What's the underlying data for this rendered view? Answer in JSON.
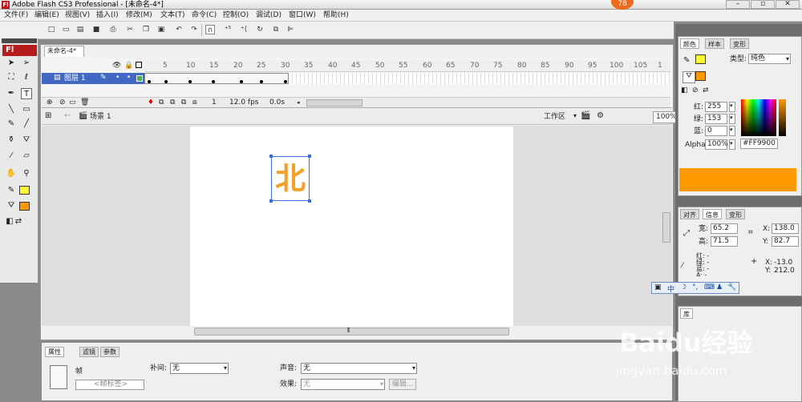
{
  "app": {
    "icon_text": "Fl",
    "title": "Adobe Flash CS3 Professional - [未命名-4*]",
    "badge": "78"
  },
  "window_buttons": [
    "–",
    "▫",
    "✕"
  ],
  "menubar": [
    "文件(F)",
    "编辑(E)",
    "视图(V)",
    "插入(I)",
    "修改(M)",
    "文本(T)",
    "命令(C)",
    "控制(O)",
    "调试(D)",
    "窗口(W)",
    "帮助(H)"
  ],
  "toolbar_icons": [
    "new-file-icon",
    "open-file-icon",
    "bridge-icon",
    "save-icon",
    "print-icon",
    "cut-icon",
    "copy-icon",
    "paste-icon",
    "undo-icon",
    "redo-icon",
    "snap-magnet-icon",
    "smooth-icon",
    "straighten-icon",
    "rotate-icon",
    "scale-icon",
    "align-icon"
  ],
  "tools": {
    "logo": "Fl",
    "items": [
      "selection-arrow-icon",
      "subselect-icon",
      "free-transform-icon",
      "lasso-icon",
      "pen-icon",
      "text-icon",
      "line-icon",
      "rectangle-icon",
      "pencil-icon",
      "brush-icon",
      "ink-bottle-icon",
      "paint-bucket-icon",
      "eyedropper-icon",
      "eraser-icon",
      "hand-icon",
      "zoom-icon"
    ]
  },
  "document": {
    "tab": "未命名-4*",
    "scene": "场景 1",
    "workspace": "工作区",
    "zoom": "100%",
    "glyph": "北"
  },
  "timeline": {
    "ticks": [
      "5",
      "10",
      "15",
      "20",
      "25",
      "30",
      "35",
      "40",
      "45",
      "50",
      "55",
      "60",
      "65",
      "70",
      "75",
      "80",
      "85",
      "90",
      "95",
      "100",
      "105",
      "1"
    ],
    "layer_name": "图层 1",
    "frame": "1",
    "fps": "12.0 fps",
    "time": "0.0s"
  },
  "color_panel": {
    "tabs": [
      "颜色",
      "样本",
      "变形"
    ],
    "type_label": "类型:",
    "type_value": "纯色",
    "red_label": "红:",
    "red": "255",
    "green_label": "绿:",
    "green": "153",
    "blue_label": "蓝:",
    "blue": "0",
    "alpha_label": "Alpha:",
    "alpha": "100%",
    "hex": "#FF9900",
    "fill_color": "#ff9900",
    "stroke_color": "#ffff33"
  },
  "info_panel": {
    "tabs": [
      "对齐",
      "信息",
      "变形"
    ],
    "width_label": "宽:",
    "width": "65.2",
    "height_label": "高:",
    "height": "71.5",
    "x_label": "X:",
    "x": "138.0",
    "y_label": "Y:",
    "y": "82.7",
    "rgb_labels": [
      "红: -",
      "绿: -",
      "蓝: -",
      "A: -"
    ],
    "cx_label": "X:",
    "cx": "-13.0",
    "cy_label": "Y:",
    "cy": "212.0"
  },
  "ime_bar": {
    "text": "中"
  },
  "library_panel": {
    "tab": "库"
  },
  "properties": {
    "tabs": [
      "属性",
      "滤镜",
      "参数"
    ],
    "frame_label": "帧",
    "frame_placeholder": "<帧标签>",
    "tween_label": "补间:",
    "tween_value": "无",
    "sound_label": "声音:",
    "sound_value": "无",
    "effect_label": "效果:",
    "effect_value": "无",
    "edit_button": "编辑..."
  },
  "watermark": {
    "logo": "Baidu经验",
    "url": "jingyan.baidu.com"
  }
}
